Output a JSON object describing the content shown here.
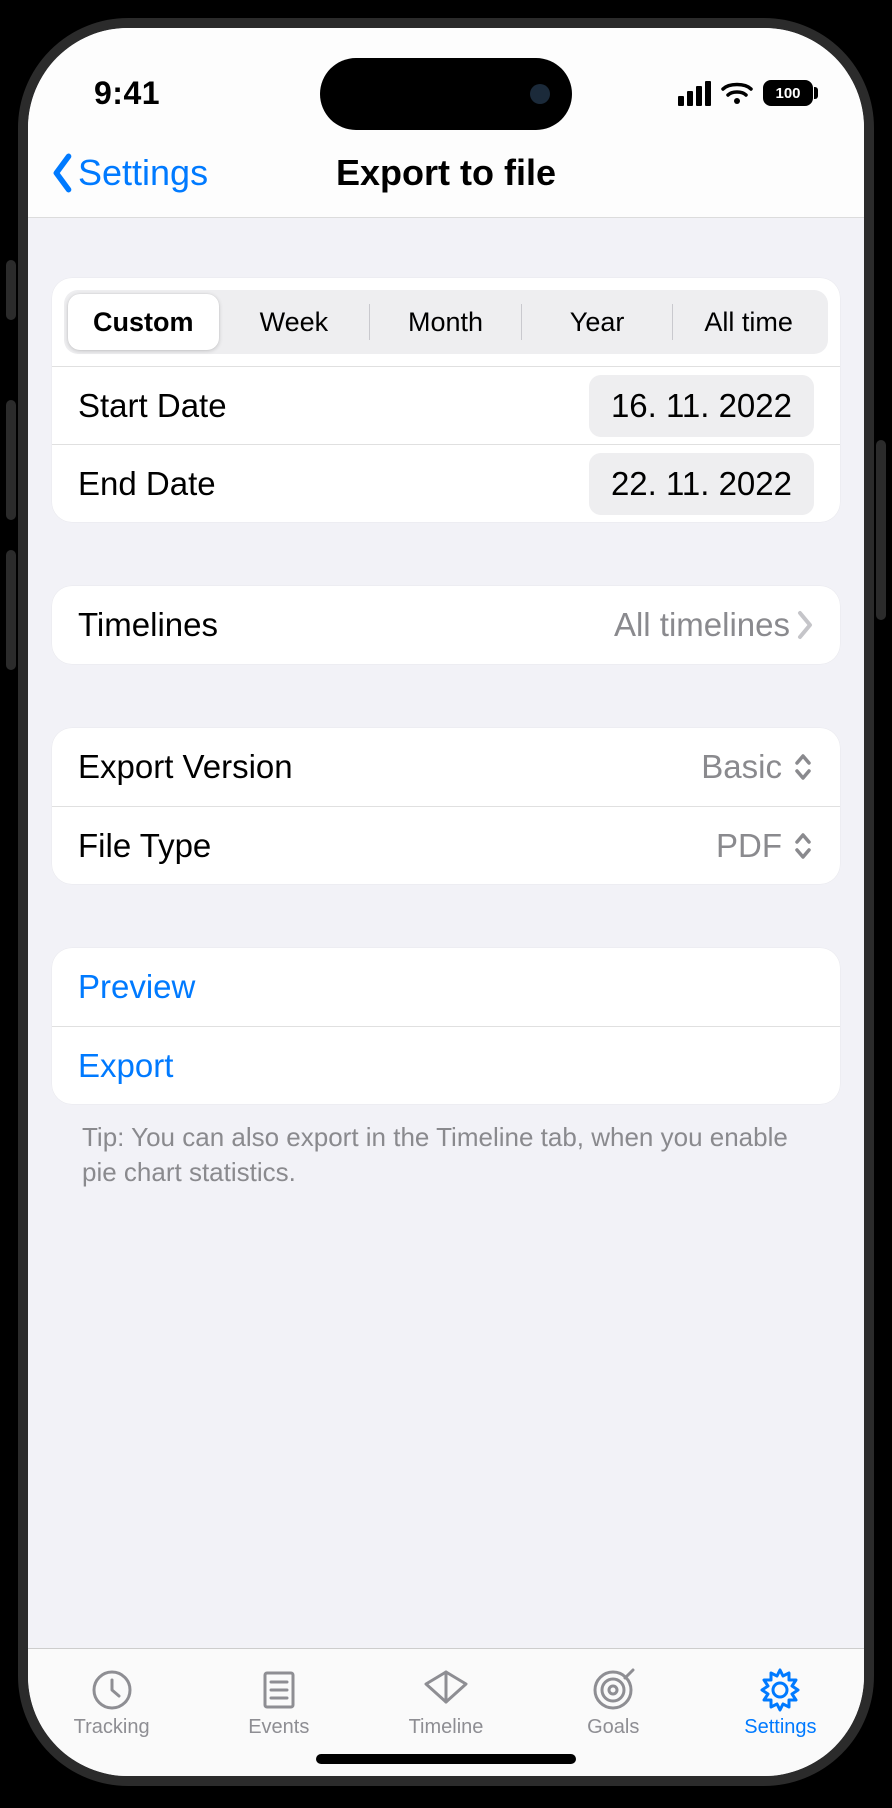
{
  "status": {
    "time": "9:41",
    "battery": "100"
  },
  "nav": {
    "back": "Settings",
    "title": "Export to file"
  },
  "range": {
    "segments": [
      "Custom",
      "Week",
      "Month",
      "Year",
      "All time"
    ],
    "selected_index": 0,
    "start_label": "Start Date",
    "start_value": "16. 11. 2022",
    "end_label": "End Date",
    "end_value": "22. 11. 2022"
  },
  "timelines": {
    "label": "Timelines",
    "value": "All timelines"
  },
  "export": {
    "version_label": "Export Version",
    "version_value": "Basic",
    "type_label": "File Type",
    "type_value": "PDF"
  },
  "actions": {
    "preview": "Preview",
    "export": "Export"
  },
  "tip": "Tip: You can also export in the Timeline tab, when you enable pie chart statistics.",
  "tabs": {
    "tracking": "Tracking",
    "events": "Events",
    "timeline": "Timeline",
    "goals": "Goals",
    "settings": "Settings"
  }
}
